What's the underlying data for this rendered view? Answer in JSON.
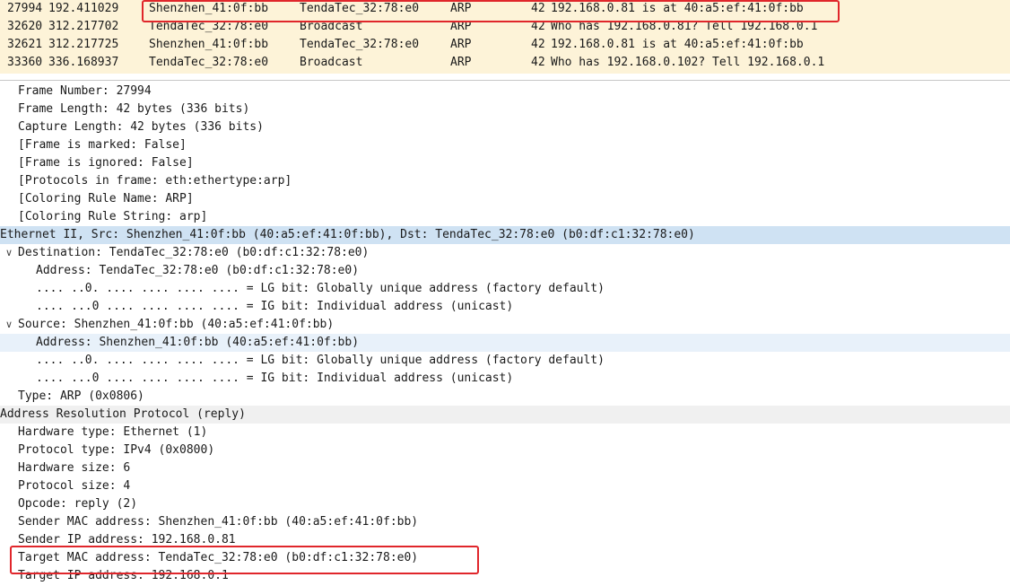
{
  "packets": [
    {
      "no": "27994",
      "time": "192.411029",
      "source": "Shenzhen_41:0f:bb",
      "destination": "TendaTec_32:78:e0",
      "protocol": "ARP",
      "length": "42",
      "info": "192.168.0.81 is at 40:a5:ef:41:0f:bb"
    },
    {
      "no": "32620",
      "time": "312.217702",
      "source": "TendaTec_32:78:e0",
      "destination": "Broadcast",
      "protocol": "ARP",
      "length": "42",
      "info": "Who has 192.168.0.81? Tell 192.168.0.1"
    },
    {
      "no": "32621",
      "time": "312.217725",
      "source": "Shenzhen_41:0f:bb",
      "destination": "TendaTec_32:78:e0",
      "protocol": "ARP",
      "length": "42",
      "info": "192.168.0.81 is at 40:a5:ef:41:0f:bb"
    },
    {
      "no": "33360",
      "time": "336.168937",
      "source": "TendaTec_32:78:e0",
      "destination": "Broadcast",
      "protocol": "ARP",
      "length": "42",
      "info": "Who has 192.168.0.102? Tell 192.168.0.1"
    }
  ],
  "details": {
    "frame": [
      "Frame Number: 27994",
      "Frame Length: 42 bytes (336 bits)",
      "Capture Length: 42 bytes (336 bits)",
      "[Frame is marked: False]",
      "[Frame is ignored: False]",
      "[Protocols in frame: eth:ethertype:arp]",
      "[Coloring Rule Name: ARP]",
      "[Coloring Rule String: arp]"
    ],
    "ethernet_header": "Ethernet II, Src: Shenzhen_41:0f:bb (40:a5:ef:41:0f:bb), Dst: TendaTec_32:78:e0 (b0:df:c1:32:78:e0)",
    "destination_header": "Destination: TendaTec_32:78:e0 (b0:df:c1:32:78:e0)",
    "destination_fields": [
      "Address: TendaTec_32:78:e0 (b0:df:c1:32:78:e0)",
      ".... ..0. .... .... .... .... = LG bit: Globally unique address (factory default)",
      ".... ...0 .... .... .... .... = IG bit: Individual address (unicast)"
    ],
    "source_header": "Source: Shenzhen_41:0f:bb (40:a5:ef:41:0f:bb)",
    "source_fields": [
      "Address: Shenzhen_41:0f:bb (40:a5:ef:41:0f:bb)",
      ".... ..0. .... .... .... .... = LG bit: Globally unique address (factory default)",
      ".... ...0 .... .... .... .... = IG bit: Individual address (unicast)"
    ],
    "type": "Type: ARP (0x0806)",
    "arp_header": "Address Resolution Protocol (reply)",
    "arp_fields": [
      "Hardware type: Ethernet (1)",
      "Protocol type: IPv4 (0x0800)",
      "Hardware size: 6",
      "Protocol size: 4",
      "Opcode: reply (2)",
      "Sender MAC address: Shenzhen_41:0f:bb (40:a5:ef:41:0f:bb)",
      "Sender IP address: 192.168.0.81",
      "Target MAC address: TendaTec_32:78:e0 (b0:df:c1:32:78:e0)",
      "Target IP address: 192.168.0.1"
    ]
  },
  "icons": {
    "expanded": "chevron-down"
  },
  "colors": {
    "packet_bg": "#fdf3d8",
    "selected_section": "#cfe2f3",
    "highlight_box": "#e0262b"
  }
}
